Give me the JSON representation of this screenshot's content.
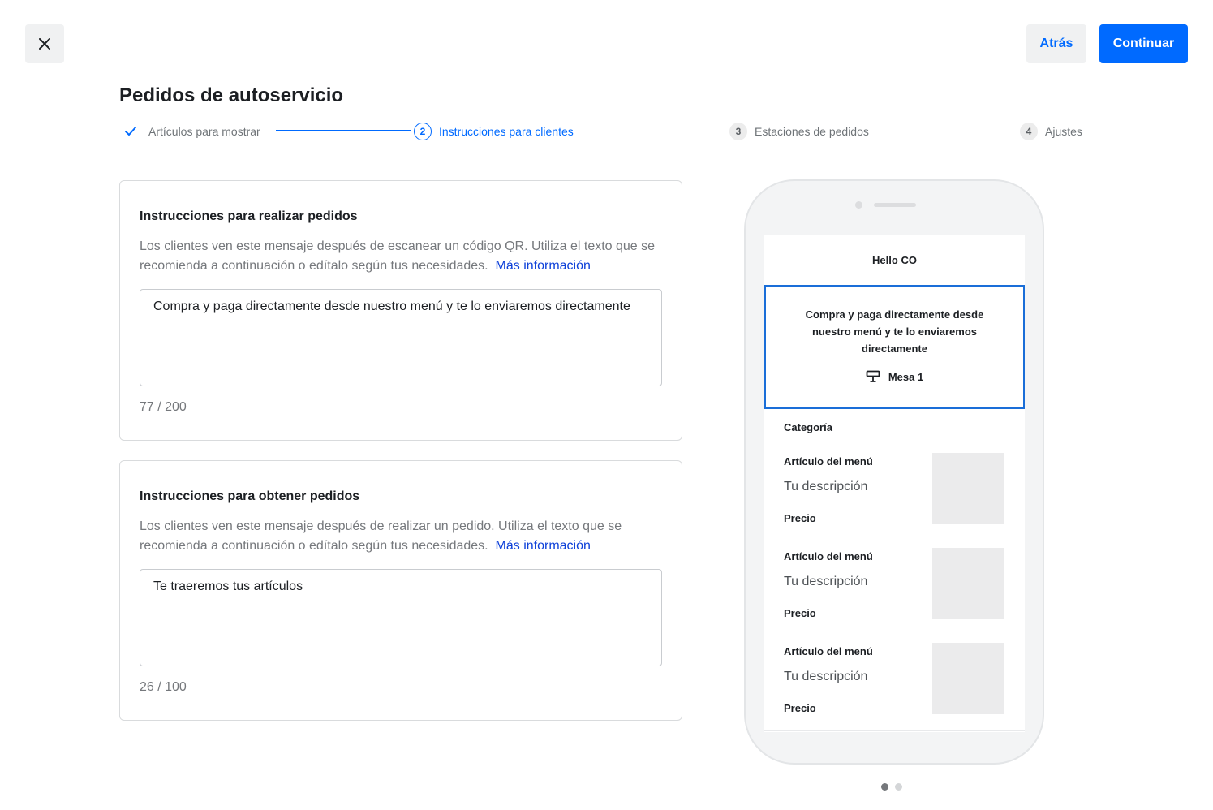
{
  "header": {
    "close_icon": "close-icon",
    "back_label": "Atrás",
    "continue_label": "Continuar",
    "title": "Pedidos de autoservicio"
  },
  "stepper": {
    "steps": [
      {
        "number": "",
        "label": "Artículos para mostrar",
        "state": "done"
      },
      {
        "number": "2",
        "label": "Instrucciones para clientes",
        "state": "active"
      },
      {
        "number": "3",
        "label": "Estaciones de pedidos",
        "state": "todo"
      },
      {
        "number": "4",
        "label": "Ajustes",
        "state": "todo"
      }
    ]
  },
  "cards": [
    {
      "title": "Instrucciones para realizar pedidos",
      "description": "Los clientes ven este mensaje después de escanear un código QR. Utiliza el texto que se recomienda a continuación o edítalo según tus necesidades.",
      "link": "Más información",
      "value": "Compra y paga directamente desde nuestro menú y te lo enviaremos directamente",
      "counter": "77 / 200"
    },
    {
      "title": "Instrucciones para obtener pedidos",
      "description": "Los clientes ven este mensaje después de realizar un pedido. Utiliza el texto que se recomienda a continuación o edítalo según tus necesidades.",
      "link": "Más información",
      "value": "Te traeremos tus artículos",
      "counter": "26 / 100"
    }
  ],
  "preview": {
    "business_name": "Hello CO",
    "instruction": "Compra y paga directamente desde nuestro menú y te lo enviaremos directamente",
    "table_icon": "table-icon",
    "table_label": "Mesa 1",
    "category": "Categoría",
    "items": [
      {
        "name": "Artículo del menú",
        "description": "Tu descripción",
        "price": "Precio"
      },
      {
        "name": "Artículo del menú",
        "description": "Tu descripción",
        "price": "Precio"
      },
      {
        "name": "Artículo del menú",
        "description": "Tu descripción",
        "price": "Precio"
      }
    ],
    "pager": {
      "total": 2,
      "active": 1
    }
  },
  "colors": {
    "accent": "#006aff",
    "link": "#0d40d9",
    "preview_highlight": "#1a6ed8"
  }
}
